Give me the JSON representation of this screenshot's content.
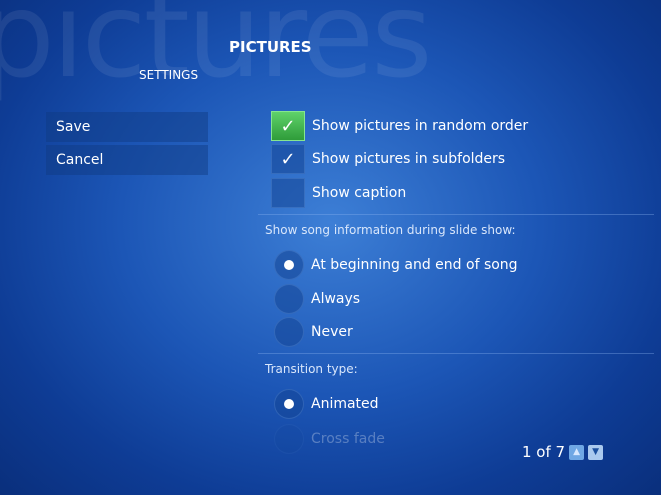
{
  "background_word": "pictures",
  "header": {
    "title": "PICTURES",
    "subtitle": "SETTINGS"
  },
  "sidebar": {
    "save": "Save",
    "cancel": "Cancel"
  },
  "options": {
    "random_order": {
      "label": "Show pictures in random order",
      "checked": true,
      "focused": true
    },
    "subfolders": {
      "label": "Show pictures in subfolders",
      "checked": true
    },
    "caption": {
      "label": "Show caption",
      "checked": false
    }
  },
  "song_info": {
    "heading": "Show song information during slide show:",
    "choices": [
      {
        "label": "At beginning and end of song",
        "selected": true
      },
      {
        "label": "Always",
        "selected": false
      },
      {
        "label": "Never",
        "selected": false
      }
    ]
  },
  "transition": {
    "heading": "Transition type:",
    "choices": [
      {
        "label": "Animated",
        "selected": true
      },
      {
        "label": "Cross fade",
        "selected": false
      }
    ]
  },
  "pager": {
    "text": "1 of 7"
  },
  "colors": {
    "focus_green": "#3fb24c",
    "bg_blue": "#1c56b6"
  }
}
